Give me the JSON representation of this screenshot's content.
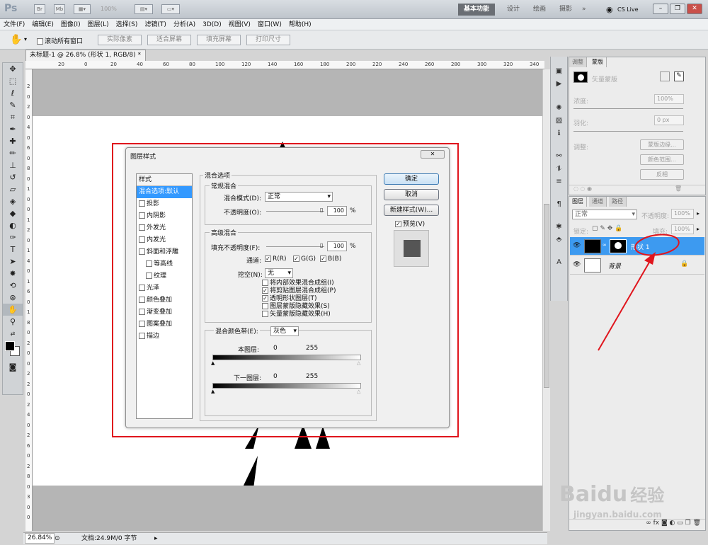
{
  "app": {
    "logo": "Ps",
    "zoom_display": "100%",
    "cs_live": "CS Live"
  },
  "workspaces": [
    "基本功能",
    "设计",
    "绘画",
    "摄影",
    "»"
  ],
  "menu": [
    "文件(F)",
    "编辑(E)",
    "图像(I)",
    "图层(L)",
    "选择(S)",
    "滤镜(T)",
    "分析(A)",
    "3D(D)",
    "视图(V)",
    "窗口(W)",
    "帮助(H)"
  ],
  "options": {
    "scroll_all": "滚动所有窗口",
    "btn1": "实际像素",
    "btn2": "适合屏幕",
    "btn3": "填充屏幕",
    "btn4": "打印尺寸"
  },
  "document": {
    "tab": "未标题-1 @ 26.8% (形状 1, RGB/8) *",
    "zoom": "26.84%",
    "doc_info": "文档:24.9M/0 字节"
  },
  "ruler_top": [
    "20",
    "0",
    "20",
    "40",
    "60",
    "80",
    "100",
    "120",
    "140",
    "160",
    "180",
    "200",
    "220",
    "240",
    "260",
    "280",
    "300",
    "320",
    "340"
  ],
  "ruler_left": [
    "2",
    "0",
    "2",
    "0",
    "4",
    "0",
    "6",
    "0",
    "8",
    "0",
    "1",
    "0",
    "0",
    "1",
    "2",
    "0",
    "1",
    "4",
    "0",
    "1",
    "6",
    "0",
    "1",
    "8",
    "0",
    "2",
    "0",
    "0",
    "2",
    "2",
    "0",
    "2",
    "4",
    "0",
    "2",
    "6",
    "0",
    "2",
    "8",
    "0",
    "3",
    "0",
    "0"
  ],
  "masks_panel": {
    "tab1": "调整",
    "tab2": "蒙版",
    "vector_mask": "矢量蒙版",
    "density_label": "浓度:",
    "density": "100%",
    "feather_label": "羽化:",
    "feather": "0 px",
    "refine_label": "调整:",
    "btn_edge": "蒙版边缘...",
    "btn_color": "颜色范围...",
    "btn_invert": "反相"
  },
  "layers_panel": {
    "tab1": "图层",
    "tab2": "通道",
    "tab3": "路径",
    "blend": "正常",
    "opacity_label": "不透明度:",
    "opacity": "100%",
    "lock_label": "锁定:",
    "fill_label": "填充:",
    "fill": "100%",
    "layers": [
      {
        "name": "形状 1",
        "selected": true
      },
      {
        "name": "背景",
        "selected": false
      }
    ]
  },
  "dialog": {
    "title": "图层样式",
    "styles_header": "样式",
    "styles": [
      "混合选项:默认",
      "投影",
      "内阴影",
      "外发光",
      "内发光",
      "斜面和浮雕",
      "等高线",
      "纹理",
      "光泽",
      "颜色叠加",
      "渐变叠加",
      "图案叠加",
      "描边"
    ],
    "blend_options": "混合选项",
    "general": "常规混合",
    "blend_mode_label": "混合模式(D):",
    "blend_mode": "正常",
    "opacity_label": "不透明度(O):",
    "opacity": "100",
    "pct": "%",
    "advanced": "高级混合",
    "fill_opacity_label": "填充不透明度(F):",
    "fill_opacity": "100",
    "channels_label": "通道:",
    "ch_r": "R(R)",
    "ch_g": "G(G)",
    "ch_b": "B(B)",
    "knockout_label": "挖空(N):",
    "knockout": "无",
    "adv_checks": [
      {
        "label": "将内部效果混合成组(I)",
        "checked": false
      },
      {
        "label": "将剪贴图层混合成组(P)",
        "checked": true
      },
      {
        "label": "透明形状图层(T)",
        "checked": true
      },
      {
        "label": "图层蒙版隐藏效果(S)",
        "checked": false
      },
      {
        "label": "矢量蒙版隐藏效果(H)",
        "checked": false
      }
    ],
    "blend_if_label": "混合颜色带(E):",
    "blend_if": "灰色",
    "this_layer": "本图层:",
    "underlying": "下一图层:",
    "v0": "0",
    "v255": "255",
    "ok": "确定",
    "cancel": "取消",
    "new_style": "新建样式(W)...",
    "preview": "预览(V)"
  },
  "watermark": {
    "brand": "Bai",
    "paw": "du",
    "cn": "经验",
    "url": "jingyan.baidu.com"
  },
  "colors": {
    "highlight": "#e0151d",
    "selection": "#3399ff",
    "layer_selected": "#3d9af0"
  }
}
